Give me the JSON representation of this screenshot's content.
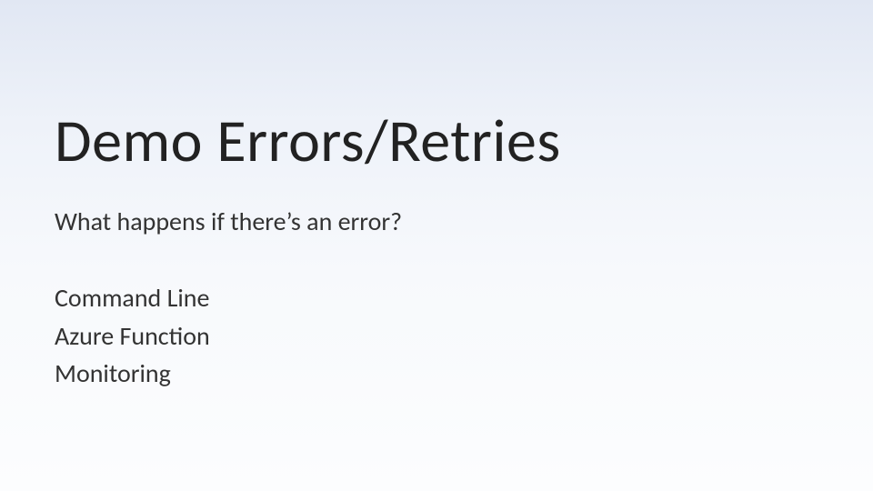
{
  "slide": {
    "title": "Demo Errors/Retries",
    "subtitle": "What happens if there’s an error?",
    "items": [
      "Command Line",
      "Azure Function",
      "Monitoring"
    ]
  }
}
